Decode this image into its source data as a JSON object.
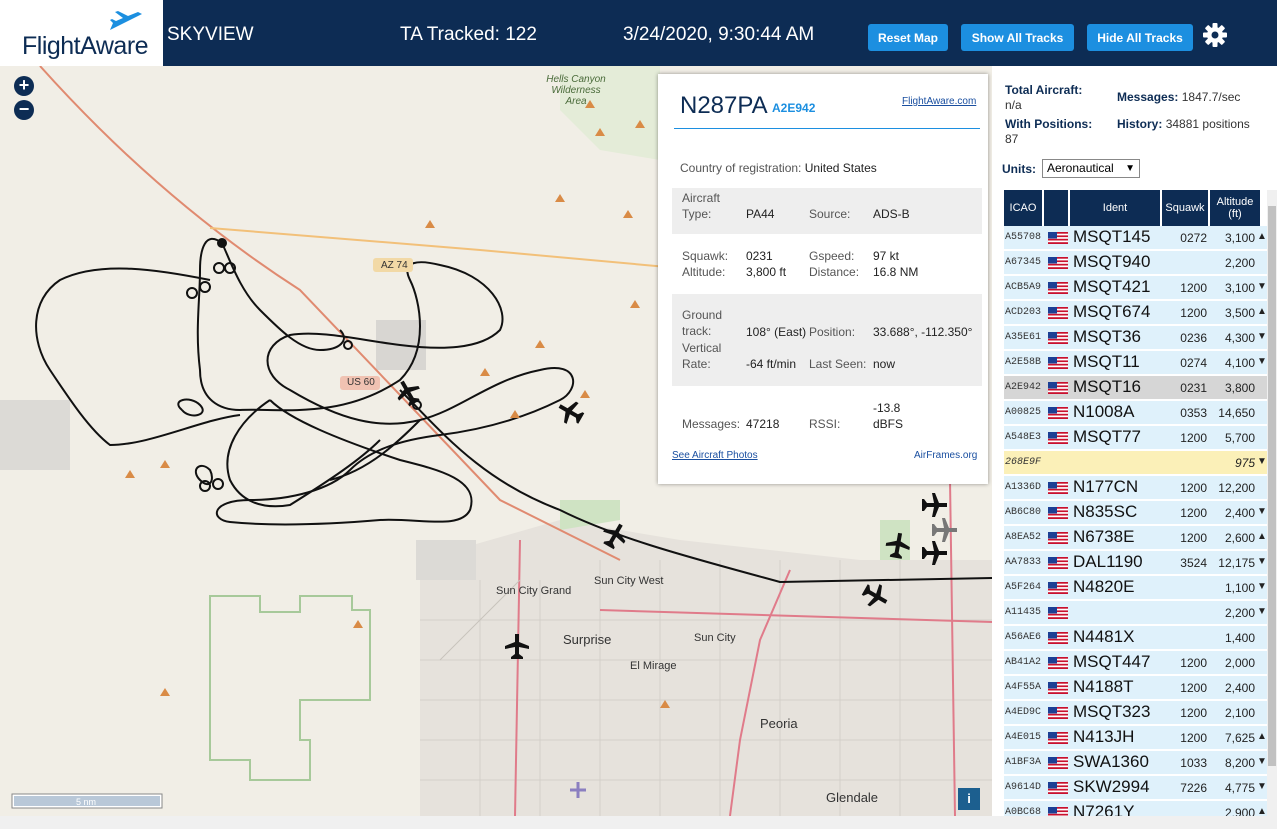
{
  "header": {
    "logo": "FlightAware",
    "title": "SKYVIEW",
    "tracked": "TA Tracked: 122",
    "datetime": "3/24/2020, 9:30:44 AM",
    "buttons": {
      "reset": "Reset Map",
      "show": "Show All Tracks",
      "hide": "Hide All Tracks"
    },
    "gear_icon": "gear-icon"
  },
  "map": {
    "zoom_in": "+",
    "zoom_out": "−",
    "scale": "5 nm",
    "info": "i",
    "labels": {
      "hells_canyon": "Hells Canyon Wilderness Area",
      "az74": "AZ 74",
      "us60": "US 60",
      "sun_city_grand": "Sun City Grand",
      "sun_city_west": "Sun City West",
      "surprise": "Surprise",
      "sun_city": "Sun City",
      "el_mirage": "El Mirage",
      "peoria": "Peoria",
      "glendale": "Glendale"
    }
  },
  "popup": {
    "ident": "N287PA",
    "icao": "A2E942",
    "link": "FlightAware.com",
    "country_label": "Country of registration:",
    "country": "United States",
    "aircraft_type_label": "Aircraft Type:",
    "aircraft_type": "PA44",
    "source_label": "Source:",
    "source": "ADS-B",
    "squawk_label": "Squawk:",
    "squawk": "0231",
    "gspeed_label": "Gspeed:",
    "gspeed": "97 kt",
    "altitude_label": "Altitude:",
    "altitude": "3,800 ft",
    "distance_label": "Distance:",
    "distance": "16.8 NM",
    "track_label": "Ground track:",
    "track": "108° (East)",
    "position_label": "Position:",
    "position": "33.688°, -112.350°",
    "vrate_label": "Vertical Rate:",
    "vrate": "-64 ft/min",
    "lastseen_label": "Last Seen:",
    "lastseen": "now",
    "messages_label": "Messages:",
    "messages": "47218",
    "rssi_label": "RSSI:",
    "rssi": "-13.8 dBFS",
    "photos": "See Aircraft Photos",
    "airframes": "AirFrames.org"
  },
  "panel": {
    "total_label": "Total Aircraft:",
    "total": "n/a",
    "msg_label": "Messages:",
    "msg": "1847.7/sec",
    "withpos_label": "With Positions:",
    "withpos": "87",
    "history_label": "History:",
    "history": "34881 positions",
    "units_label": "Units:",
    "units": "Aeronautical",
    "columns": [
      "ICAO",
      "Ident",
      "Squawk",
      "Altitude (ft)"
    ],
    "rows": [
      {
        "icao": "A55708",
        "ident": "MSQT145",
        "squawk": "0272",
        "alt": "3,100",
        "arrow": "▲"
      },
      {
        "icao": "A67345",
        "ident": "MSQT940",
        "squawk": "",
        "alt": "2,200",
        "arrow": ""
      },
      {
        "icao": "ACB5A9",
        "ident": "MSQT421",
        "squawk": "1200",
        "alt": "3,100",
        "arrow": "▼"
      },
      {
        "icao": "ACD203",
        "ident": "MSQT674",
        "squawk": "1200",
        "alt": "3,500",
        "arrow": "▲"
      },
      {
        "icao": "A35E61",
        "ident": "MSQT36",
        "squawk": "0236",
        "alt": "4,300",
        "arrow": "▼"
      },
      {
        "icao": "A2E58B",
        "ident": "MSQT11",
        "squawk": "0274",
        "alt": "4,100",
        "arrow": "▼"
      },
      {
        "icao": "A2E942",
        "ident": "MSQT16",
        "squawk": "0231",
        "alt": "3,800",
        "arrow": ""
      },
      {
        "icao": "A00825",
        "ident": "N1008A",
        "squawk": "0353",
        "alt": "14,650",
        "arrow": ""
      },
      {
        "icao": "A548E3",
        "ident": "MSQT77",
        "squawk": "1200",
        "alt": "5,700",
        "arrow": ""
      },
      {
        "icao": "268E9F",
        "ident": "",
        "squawk": "",
        "alt": "975",
        "arrow": "▼"
      },
      {
        "icao": "A1336D",
        "ident": "N177CN",
        "squawk": "1200",
        "alt": "12,200",
        "arrow": ""
      },
      {
        "icao": "AB6C80",
        "ident": "N835SC",
        "squawk": "1200",
        "alt": "2,400",
        "arrow": "▼"
      },
      {
        "icao": "A8EA52",
        "ident": "N6738E",
        "squawk": "1200",
        "alt": "2,600",
        "arrow": "▲"
      },
      {
        "icao": "AA7833",
        "ident": "DAL1190",
        "squawk": "3524",
        "alt": "12,175",
        "arrow": "▼"
      },
      {
        "icao": "A5F264",
        "ident": "N4820E",
        "squawk": "",
        "alt": "1,100",
        "arrow": "▼"
      },
      {
        "icao": "A11435",
        "ident": "",
        "squawk": "",
        "alt": "2,200",
        "arrow": "▼"
      },
      {
        "icao": "A56AE6",
        "ident": "N4481X",
        "squawk": "",
        "alt": "1,400",
        "arrow": ""
      },
      {
        "icao": "AB41A2",
        "ident": "MSQT447",
        "squawk": "1200",
        "alt": "2,000",
        "arrow": ""
      },
      {
        "icao": "A4F55A",
        "ident": "N4188T",
        "squawk": "1200",
        "alt": "2,400",
        "arrow": ""
      },
      {
        "icao": "A4ED9C",
        "ident": "MSQT323",
        "squawk": "1200",
        "alt": "2,100",
        "arrow": ""
      },
      {
        "icao": "A4E015",
        "ident": "N413JH",
        "squawk": "1200",
        "alt": "7,625",
        "arrow": "▲"
      },
      {
        "icao": "A1BF3A",
        "ident": "SWA1360",
        "squawk": "1033",
        "alt": "8,200",
        "arrow": "▼"
      },
      {
        "icao": "A9614D",
        "ident": "SKW2994",
        "squawk": "7226",
        "alt": "4,775",
        "arrow": "▼"
      },
      {
        "icao": "A0BC68",
        "ident": "N7261Y",
        "squawk": "",
        "alt": "2,900",
        "arrow": "▲"
      }
    ]
  }
}
